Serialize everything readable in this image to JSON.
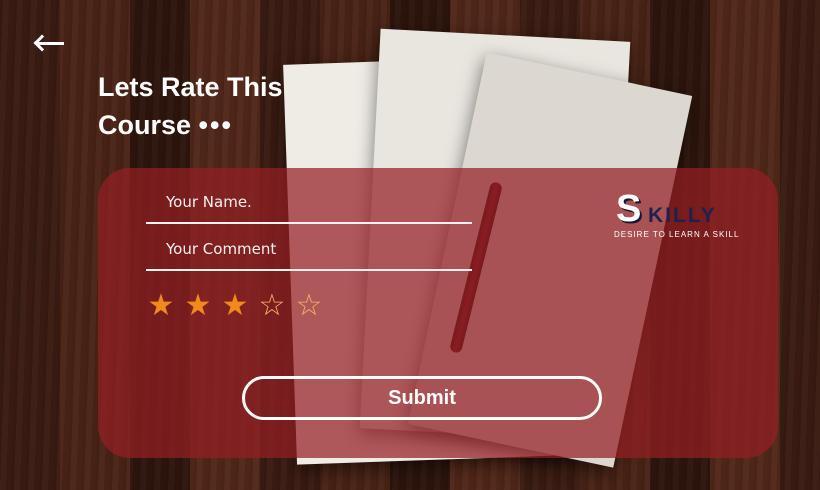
{
  "header": {
    "title_line1": "Lets Rate This",
    "title_line2": "Course",
    "title_dots": "•••"
  },
  "form": {
    "name_placeholder": "Your Name.",
    "name_value": "",
    "comment_placeholder": "Your Comment",
    "comment_value": "",
    "rating": {
      "value": 3,
      "max": 5,
      "filled_glyph": "★",
      "empty_glyph": "☆"
    },
    "submit_label": "Submit"
  },
  "brand": {
    "logo_letter": "S",
    "logo_word": "KILLY",
    "tagline": "DESIRE TO LEARN A SKILL"
  },
  "colors": {
    "card": "#961e24",
    "star": "#f08a1c",
    "text": "#ffffff"
  }
}
